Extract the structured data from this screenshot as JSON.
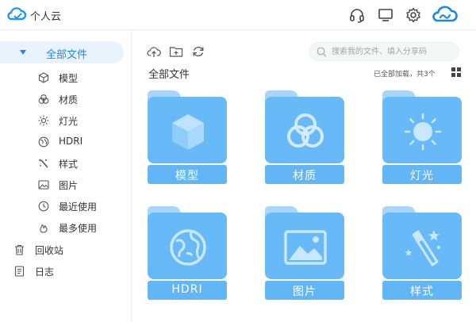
{
  "app": {
    "title": "个人云"
  },
  "header": {
    "icons": [
      "headset-icon",
      "monitor-icon",
      "gear-icon",
      "cloud-brand-icon"
    ]
  },
  "sidebar": {
    "root": {
      "label": "全部文件",
      "expanded": true
    },
    "children": [
      {
        "label": "模型",
        "icon": "cube-icon"
      },
      {
        "label": "材质",
        "icon": "material-icon"
      },
      {
        "label": "灯光",
        "icon": "light-icon"
      },
      {
        "label": "HDRI",
        "icon": "hdri-icon"
      },
      {
        "label": "样式",
        "icon": "style-icon"
      },
      {
        "label": "图片",
        "icon": "image-icon"
      },
      {
        "label": "最近使用",
        "icon": "clock-icon"
      },
      {
        "label": "最多使用",
        "icon": "fire-icon"
      }
    ],
    "bottom": [
      {
        "label": "回收站",
        "icon": "trash-icon"
      },
      {
        "label": "日志",
        "icon": "log-icon"
      }
    ]
  },
  "toolbar": {
    "search_placeholder": "搜索我的文件、填入分享码"
  },
  "main": {
    "section_title": "全部文件",
    "load_status": "已全部加载，共3个",
    "folders": [
      {
        "name": "模型",
        "icon": "cube-icon"
      },
      {
        "name": "材质",
        "icon": "material-icon"
      },
      {
        "name": "灯光",
        "icon": "sun-icon"
      },
      {
        "name": "HDRI",
        "icon": "globe-icon"
      },
      {
        "name": "图片",
        "icon": "image-icon"
      },
      {
        "name": "样式",
        "icon": "magic-wand-icon"
      }
    ]
  },
  "colors": {
    "accent": "#1e88e5",
    "folder_body": "#67b9f7",
    "folder_tab": "#a8d6fb",
    "nav_active_bg": "#e8f3fe"
  }
}
